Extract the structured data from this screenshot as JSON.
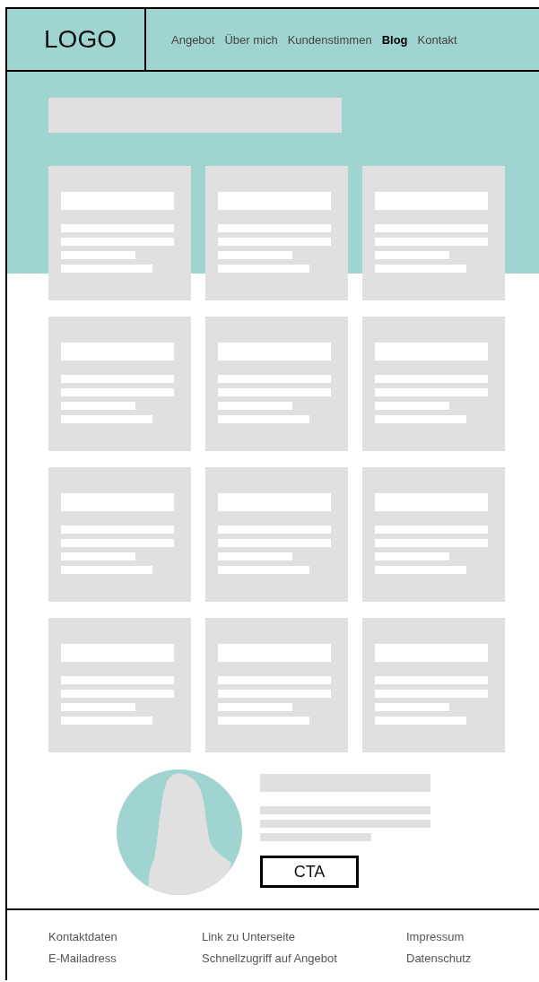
{
  "header": {
    "logo": "LOGO",
    "nav": [
      {
        "label": "Angebot",
        "selected": false
      },
      {
        "label": "Über mich",
        "selected": false
      },
      {
        "label": "Kundenstimmen",
        "selected": false
      },
      {
        "label": "Blog",
        "selected": true
      },
      {
        "label": "Kontakt",
        "selected": false
      }
    ]
  },
  "blog_cards": [
    {
      "kind": "placeholder"
    },
    {
      "kind": "placeholder"
    },
    {
      "kind": "placeholder"
    },
    {
      "kind": "placeholder"
    },
    {
      "kind": "placeholder"
    },
    {
      "kind": "placeholder"
    },
    {
      "kind": "placeholder"
    },
    {
      "kind": "placeholder"
    },
    {
      "kind": "placeholder"
    },
    {
      "kind": "placeholder"
    },
    {
      "kind": "placeholder"
    },
    {
      "kind": "placeholder"
    }
  ],
  "profile": {
    "cta": "CTA"
  },
  "footer": {
    "columns": [
      {
        "links": [
          "Kontaktdaten",
          "E-Mailadress"
        ]
      },
      {
        "links": [
          "Link zu Unterseite",
          "Schnellzugriff auf Angebot"
        ]
      },
      {
        "links": [
          "Impressum",
          "Datenschutz"
        ]
      }
    ]
  }
}
